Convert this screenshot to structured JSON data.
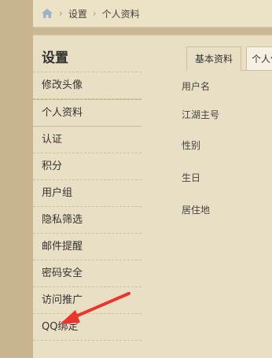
{
  "breadcrumb": {
    "items": [
      "设置",
      "个人资料"
    ]
  },
  "sidebar": {
    "title": "设置",
    "items": [
      {
        "label": "修改头像"
      },
      {
        "label": "个人资料"
      },
      {
        "label": "认证"
      },
      {
        "label": "积分"
      },
      {
        "label": "用户组"
      },
      {
        "label": "隐私筛选"
      },
      {
        "label": "邮件提醒"
      },
      {
        "label": "密码安全"
      },
      {
        "label": "访问推广"
      },
      {
        "label": "QQ绑定"
      }
    ]
  },
  "tabs": [
    {
      "label": "基本资料"
    },
    {
      "label": "个人信"
    }
  ],
  "fields": [
    {
      "label": "用户名"
    },
    {
      "label": "江湖主号"
    },
    {
      "label": "性别"
    },
    {
      "label": "生日"
    },
    {
      "label": "居住地"
    }
  ],
  "colors": {
    "arrow": "#e8362e",
    "accent_bg": "#e9dfc4"
  },
  "icons": {
    "home": "home-icon",
    "arrow": "red-arrow-icon"
  }
}
